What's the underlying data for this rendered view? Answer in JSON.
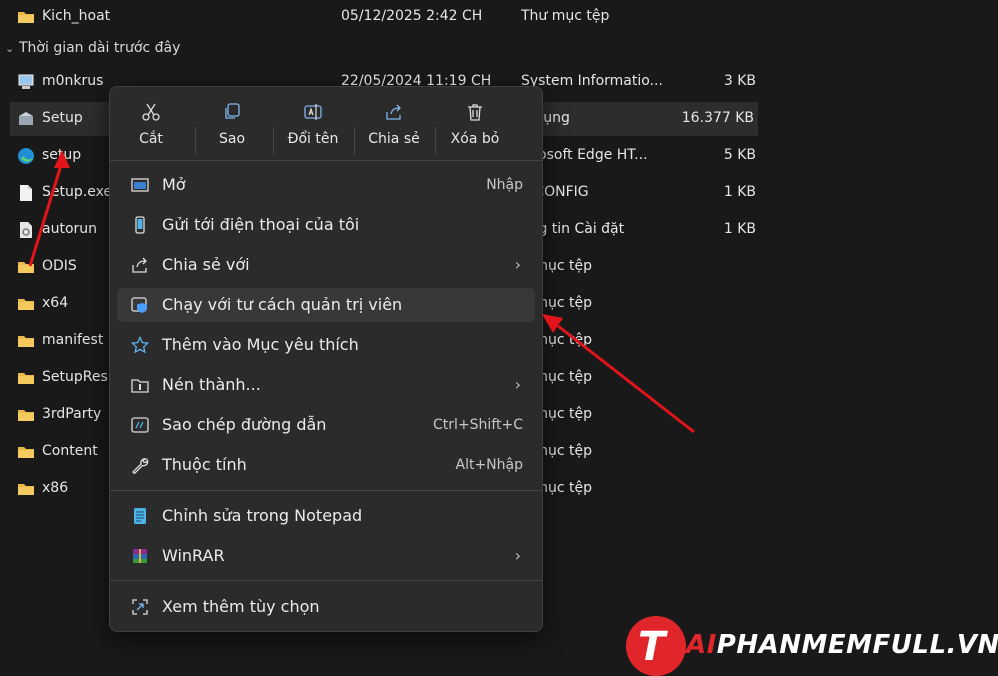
{
  "files": {
    "top_row": {
      "name": "Kich_hoat",
      "date": "05/12/2025 2:42 CH",
      "type": "Thư mục tệp",
      "size": "",
      "icon": "folder-icon"
    },
    "group_label": "Thời gian dài trước đây",
    "rows": [
      {
        "name": "m0nkrus",
        "date": "22/05/2024 11:19 CH",
        "type": "System Informatio...",
        "size": "3 KB",
        "icon": "sysinfo-icon"
      },
      {
        "name": "Setup",
        "date": "",
        "type": "g dụng",
        "size": "16.377 KB",
        "icon": "setup-icon",
        "selected": true
      },
      {
        "name": "setup",
        "date": "",
        "type": "icrosoft Edge HT...",
        "size": "5 KB",
        "icon": "edge-icon"
      },
      {
        "name": "Setup.exe.",
        "date": "",
        "type": "p CONFIG",
        "size": "1 KB",
        "icon": "file-icon"
      },
      {
        "name": "autorun",
        "date": "",
        "type": "ông tin Cài đặt",
        "size": "1 KB",
        "icon": "gear-file-icon"
      },
      {
        "name": "ODIS",
        "date": "",
        "type": "ư mục tệp",
        "size": "",
        "icon": "folder-icon"
      },
      {
        "name": "x64",
        "date": "",
        "type": "ư mục tệp",
        "size": "",
        "icon": "folder-icon"
      },
      {
        "name": "manifest",
        "date": "",
        "type": "ư mục tệp",
        "size": "",
        "icon": "folder-icon"
      },
      {
        "name": "SetupRes",
        "date": "",
        "type": "ư mục tệp",
        "size": "",
        "icon": "folder-icon"
      },
      {
        "name": "3rdParty",
        "date": "",
        "type": "ư mục tệp",
        "size": "",
        "icon": "folder-icon"
      },
      {
        "name": "Content",
        "date": "",
        "type": "ư mục tệp",
        "size": "",
        "icon": "folder-icon"
      },
      {
        "name": "x86",
        "date": "",
        "type": "ư mục tệp",
        "size": "",
        "icon": "folder-icon"
      }
    ]
  },
  "menu": {
    "toolbar": [
      {
        "label": "Cắt",
        "icon": "scissors-icon"
      },
      {
        "label": "Sao",
        "icon": "copy-icon"
      },
      {
        "label": "Đổi tên",
        "icon": "rename-icon"
      },
      {
        "label": "Chia sẻ",
        "icon": "share-icon"
      },
      {
        "label": "Xóa bỏ",
        "icon": "trash-icon"
      }
    ],
    "items": [
      {
        "label": "Mở",
        "shortcut": "Nhập",
        "icon": "open-window-icon"
      },
      {
        "label": "Gửi tới điện thoại của tôi",
        "shortcut": "",
        "icon": "phone-icon"
      },
      {
        "label": "Chia sẻ với",
        "shortcut": "",
        "icon": "share-with-icon",
        "submenu": true
      },
      {
        "label": "Chạy với tư cách quản trị viên",
        "shortcut": "",
        "icon": "shield-window-icon",
        "hover": true
      },
      {
        "label": "Thêm vào Mục yêu thích",
        "shortcut": "",
        "icon": "star-icon"
      },
      {
        "label": "Nén thành...",
        "shortcut": "",
        "icon": "zip-folder-icon",
        "submenu": true
      },
      {
        "label": "Sao chép đường dẫn",
        "shortcut": "Ctrl+Shift+C",
        "icon": "copy-path-icon"
      },
      {
        "label": "Thuộc tính",
        "shortcut": "Alt+Nhập",
        "icon": "wrench-icon"
      }
    ],
    "extra_items": [
      {
        "label": "Chỉnh sửa trong Notepad",
        "icon": "notepad-icon"
      },
      {
        "label": "WinRAR",
        "icon": "winrar-icon",
        "submenu": true
      }
    ],
    "more_item": {
      "label": "Xem thêm tùy chọn",
      "icon": "more-options-icon"
    }
  },
  "logo": {
    "prefix": "T",
    "red_part": "AI",
    "white_part": "PHANMEMFULL.VN"
  },
  "colors": {
    "accent_red": "#e0262b",
    "folder": "#e8b84a",
    "arrow": "#e0141a"
  }
}
